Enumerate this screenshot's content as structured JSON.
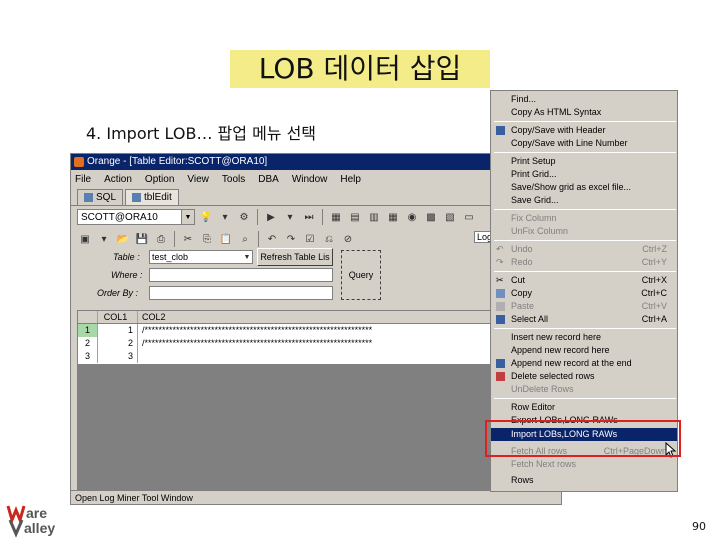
{
  "slide": {
    "title": "LOB 데이터 삽입",
    "subtitle": "4. Import LOB… 팝업 메뉴 선택",
    "page_number": "90",
    "logo_text_1": "Ware",
    "logo_text_2": "Valley"
  },
  "app": {
    "window_title": "Orange - [Table Editor:SCOTT@ORA10]",
    "menu": [
      "File",
      "Action",
      "Option",
      "View",
      "Tools",
      "DBA",
      "Window",
      "Help"
    ],
    "tabs": [
      "SQL",
      "tblEdit"
    ],
    "connection": "SCOTT@ORA10",
    "log_label": "Log",
    "filter": {
      "table_label": "Table :",
      "table_value": "test_clob",
      "where_label": "Where :",
      "orderby_label": "Order By :",
      "refresh_button": "Refresh Table Lis",
      "query_button": "Query"
    },
    "grid": {
      "columns": [
        "COL1",
        "COL2"
      ],
      "rows": [
        {
          "num": "1",
          "col1": "1",
          "col2": "/*****************************************************************"
        },
        {
          "num": "2",
          "col1": "2",
          "col2": "/*****************************************************************"
        },
        {
          "num": "3",
          "col1": "3",
          "col2": ""
        }
      ]
    },
    "status": "Open Log Miner Tool Window"
  },
  "context_menu": {
    "items": [
      {
        "label": "Find...",
        "shortcut": "",
        "disabled": false
      },
      {
        "label": "Copy As HTML Syntax",
        "shortcut": "",
        "disabled": false
      },
      {
        "label": "Copy/Save with Header",
        "shortcut": "",
        "disabled": false
      },
      {
        "label": "Copy/Save with Line Number",
        "shortcut": "",
        "disabled": false
      },
      {
        "label": "Print Setup",
        "shortcut": "",
        "disabled": false
      },
      {
        "label": "Print Grid...",
        "shortcut": "",
        "disabled": false
      },
      {
        "label": "Save/Show grid as excel file...",
        "shortcut": "",
        "disabled": false
      },
      {
        "label": "Save Grid...",
        "shortcut": "",
        "disabled": false
      },
      {
        "label": "Fix Column",
        "shortcut": "",
        "disabled": true
      },
      {
        "label": "UnFix Column",
        "shortcut": "",
        "disabled": true
      },
      {
        "label": "Undo",
        "shortcut": "Ctrl+Z",
        "disabled": true
      },
      {
        "label": "Redo",
        "shortcut": "Ctrl+Y",
        "disabled": true
      },
      {
        "label": "Cut",
        "shortcut": "Ctrl+X",
        "disabled": false
      },
      {
        "label": "Copy",
        "shortcut": "Ctrl+C",
        "disabled": false
      },
      {
        "label": "Paste",
        "shortcut": "Ctrl+V",
        "disabled": true
      },
      {
        "label": "Select All",
        "shortcut": "Ctrl+A",
        "disabled": false
      },
      {
        "label": "Insert new record here",
        "shortcut": "",
        "disabled": false
      },
      {
        "label": "Append new record here",
        "shortcut": "",
        "disabled": false
      },
      {
        "label": "Append new record at the end",
        "shortcut": "",
        "disabled": false
      },
      {
        "label": "Delete selected rows",
        "shortcut": "",
        "disabled": false
      },
      {
        "label": "UnDelete Rows",
        "shortcut": "",
        "disabled": true
      },
      {
        "label": "Row Editor",
        "shortcut": "",
        "disabled": false
      },
      {
        "label": "Export LOBs,LONG RAWs",
        "shortcut": "",
        "disabled": false
      },
      {
        "label": "Import LOBs,LONG RAWs",
        "shortcut": "",
        "disabled": false,
        "highlighted": true
      },
      {
        "label": "Fetch All rows",
        "shortcut": "Ctrl+PageDown",
        "disabled": true
      },
      {
        "label": "Fetch Next rows",
        "shortcut": "",
        "disabled": true
      },
      {
        "label": "Rows",
        "shortcut": "",
        "disabled": false
      }
    ]
  },
  "colors": {
    "title_highlight": "#f3ec88",
    "menu_highlight": "#0a246a",
    "callout_border": "#e02020",
    "logo_red": "#c8281e",
    "logo_dark": "#555555"
  }
}
